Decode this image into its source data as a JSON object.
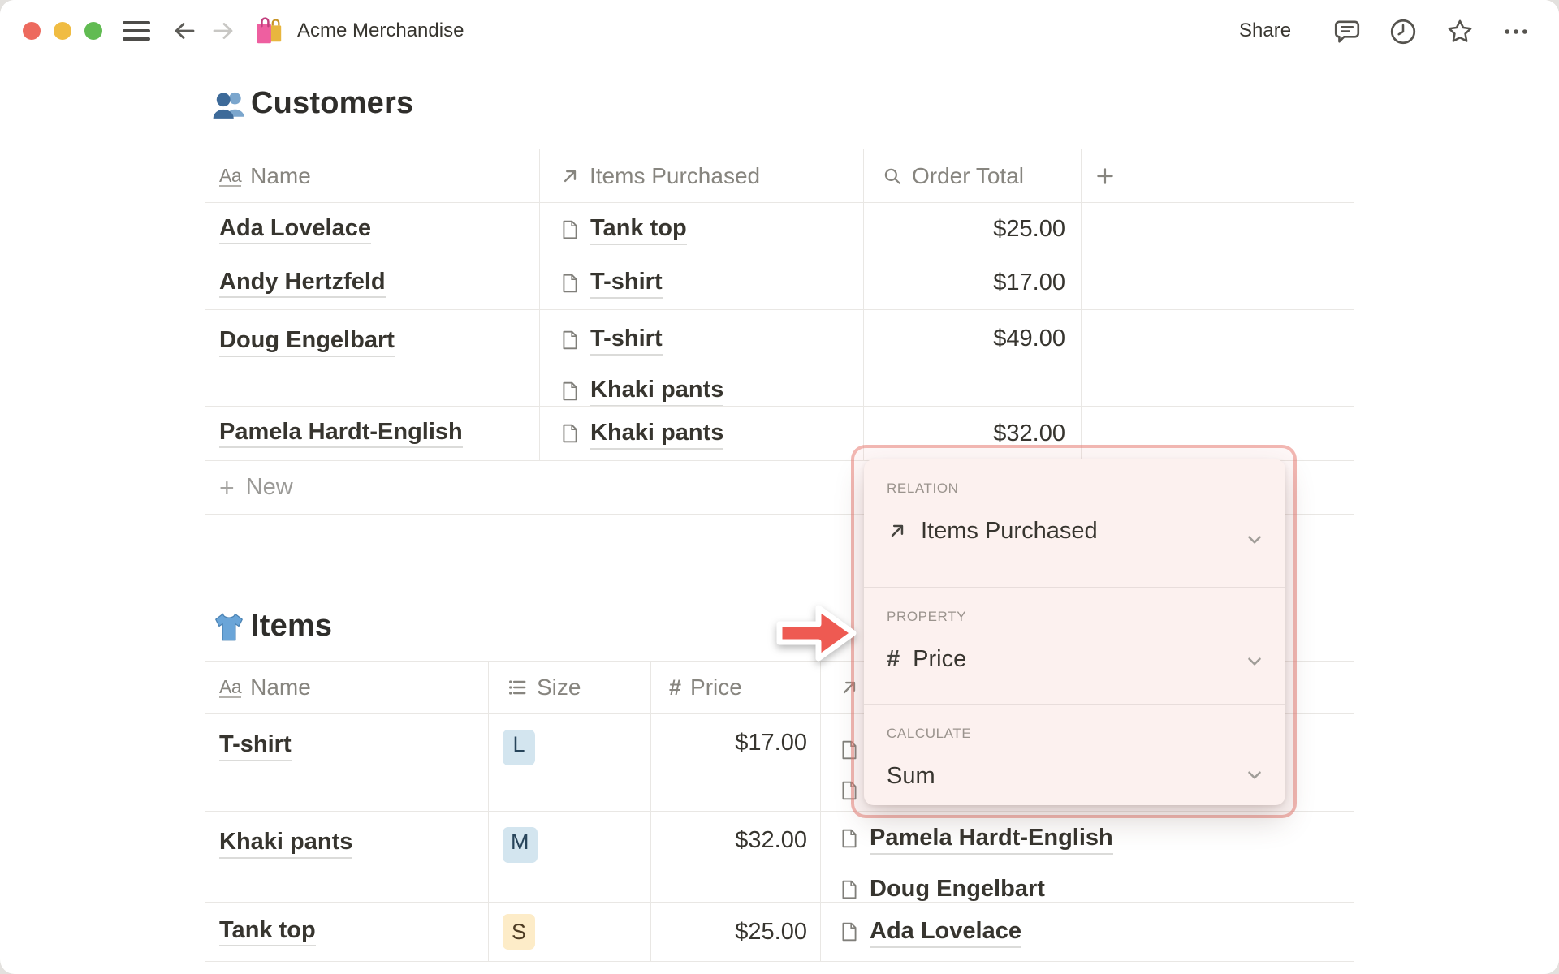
{
  "window": {
    "emoji": "shopping-bags",
    "title": "Acme Merchandise",
    "share_label": "Share"
  },
  "customers": {
    "title": "Customers",
    "emoji": "busts-in-silhouette",
    "columns": [
      {
        "icon": "text",
        "label": "Name"
      },
      {
        "icon": "relation",
        "label": "Items Purchased"
      },
      {
        "icon": "rollup",
        "label": "Order Total"
      },
      {
        "icon": "plus",
        "label": ""
      }
    ],
    "rows": [
      {
        "name": "Ada Lovelace",
        "items": [
          "Tank top"
        ],
        "order_total": "$25.00"
      },
      {
        "name": "Andy Hertzfeld",
        "items": [
          "T-shirt"
        ],
        "order_total": "$17.00"
      },
      {
        "name": "Doug Engelbart",
        "items": [
          "T-shirt",
          "Khaki pants"
        ],
        "order_total": "$49.00"
      },
      {
        "name": "Pamela Hardt-English",
        "items": [
          "Khaki pants"
        ],
        "order_total": "$32.00"
      }
    ],
    "new_row_label": "New"
  },
  "items": {
    "title": "Items",
    "emoji": "t-shirt",
    "columns": [
      {
        "icon": "text",
        "label": "Name"
      },
      {
        "icon": "select",
        "label": "Size"
      },
      {
        "icon": "number",
        "label": "Price"
      },
      {
        "icon": "relation",
        "label": ""
      }
    ],
    "rows": [
      {
        "name": "T-shirt",
        "size": "L",
        "size_color": "blue",
        "price": "$17.00",
        "purchasers": [
          "",
          ""
        ]
      },
      {
        "name": "Khaki pants",
        "size": "M",
        "size_color": "blue",
        "price": "$32.00",
        "purchasers": [
          "Pamela Hardt-English",
          "Doug Engelbart"
        ]
      },
      {
        "name": "Tank top",
        "size": "S",
        "size_color": "yellow",
        "price": "$25.00",
        "purchasers": [
          "Ada Lovelace"
        ]
      }
    ]
  },
  "popup": {
    "relation_label": "RELATION",
    "relation_value": "Items Purchased",
    "property_label": "PROPERTY",
    "property_value": "Price",
    "calculate_label": "CALCULATE",
    "calculate_value": "Sum"
  },
  "colors": {
    "accent_arrow": "#ee5a52",
    "highlight_border": "#e7786e",
    "popup_bg": "#fcf1ef",
    "badge_blue": "#d3e5ef",
    "badge_yellow": "#fdecc8",
    "text_primary": "#37352f",
    "text_secondary": "#87857f",
    "traffic_red": "#ed6a5e",
    "traffic_yellow": "#f0bc42",
    "traffic_green": "#61bb52"
  }
}
